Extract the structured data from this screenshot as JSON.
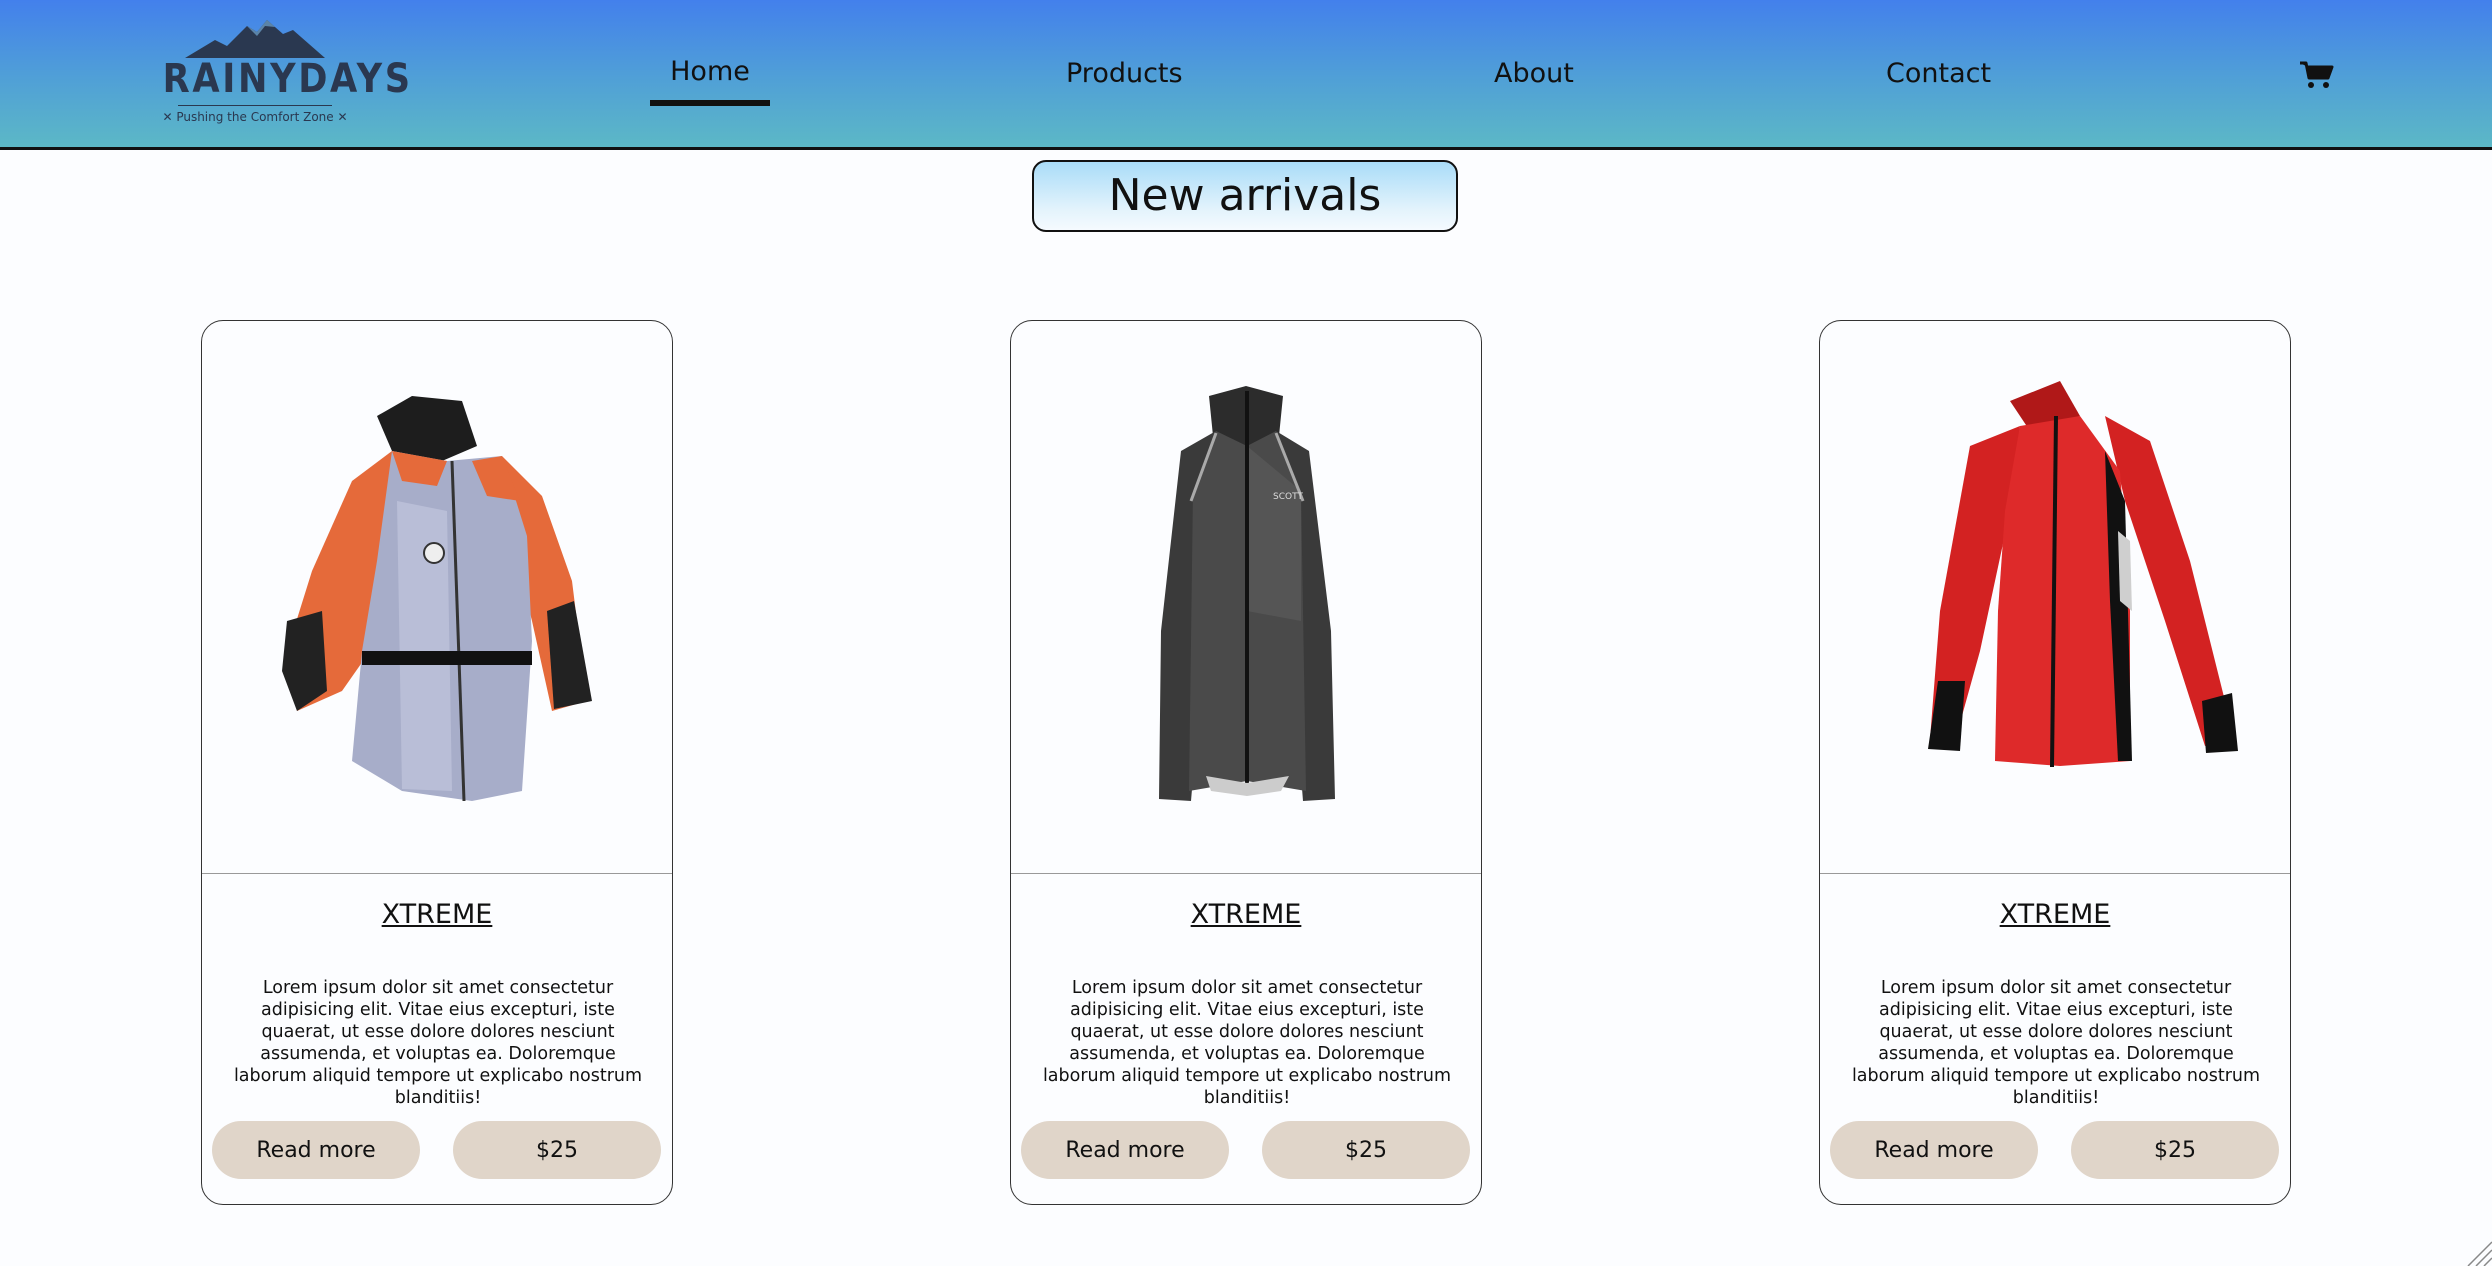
{
  "header": {
    "logo": {
      "brand": "RAINYDAYS",
      "tagline": "✕ Pushing the Comfort Zone ✕"
    },
    "nav": [
      {
        "label": "Home",
        "active": true
      },
      {
        "label": "Products"
      },
      {
        "label": "About"
      },
      {
        "label": "Contact"
      }
    ],
    "cart_icon": "cart-icon"
  },
  "main": {
    "section_title": "New arrivals",
    "products": [
      {
        "image": "orange-grey-jacket",
        "title": "XTREME",
        "description": "Lorem ipsum dolor sit amet consectetur adipisicing elit. Vitae eius excepturi, iste quaerat, ut esse dolore dolores nesciunt assumenda, et voluptas ea. Doloremque laborum aliquid tempore ut explicabo nostrum blanditiis!",
        "read_more": "Read more",
        "price": "$25"
      },
      {
        "image": "black-jacket",
        "title": "XTREME",
        "description": "Lorem ipsum dolor sit amet consectetur adipisicing elit. Vitae eius excepturi, iste quaerat, ut esse dolore dolores nesciunt assumenda, et voluptas ea. Doloremque laborum aliquid tempore ut explicabo nostrum blanditiis!",
        "read_more": "Read more",
        "price": "$25"
      },
      {
        "image": "red-jacket",
        "title": "XTREME",
        "description": "Lorem ipsum dolor sit amet consectetur adipisicing elit. Vitae eius excepturi, iste quaerat, ut esse dolore dolores nesciunt assumenda, et voluptas ea. Doloremque laborum aliquid tempore ut explicabo nostrum blanditiis!",
        "read_more": "Read more",
        "price": "$25"
      }
    ]
  },
  "colors": {
    "header_top": "#4380ec",
    "header_bottom": "#5cb8c6",
    "button_bg": "#e0d5c9",
    "title_bg": "#a9dcf8"
  }
}
